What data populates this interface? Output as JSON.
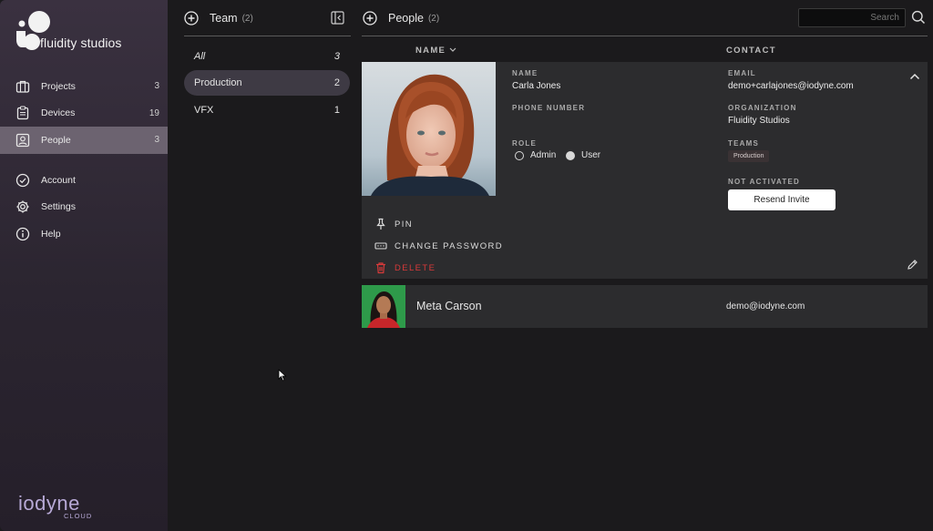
{
  "sidebar": {
    "logo_text": "fluidity studios",
    "items": [
      {
        "label": "Projects",
        "count": "3"
      },
      {
        "label": "Devices",
        "count": "19"
      },
      {
        "label": "People",
        "count": "3"
      },
      {
        "label": "Account",
        "count": ""
      },
      {
        "label": "Settings",
        "count": ""
      },
      {
        "label": "Help",
        "count": ""
      }
    ],
    "brand": "iodyne",
    "brand_sub": "CLOUD"
  },
  "team": {
    "title": "Team",
    "count": "(2)",
    "items": [
      {
        "label": "All",
        "count": "3"
      },
      {
        "label": "Production",
        "count": "2"
      },
      {
        "label": "VFX",
        "count": "1"
      }
    ]
  },
  "people": {
    "title": "People",
    "count": "(2)",
    "search_placeholder": "Search",
    "columns": {
      "name": "NAME",
      "contact": "CONTACT"
    },
    "expanded": {
      "name_label": "NAME",
      "name": "Carla Jones",
      "phone_label": "PHONE NUMBER",
      "role_label": "ROLE",
      "role_admin": "Admin",
      "role_user": "User",
      "email_label": "EMAIL",
      "email": "demo+carlajones@iodyne.com",
      "org_label": "ORGANIZATION",
      "org": "Fluidity Studios",
      "teams_label": "TEAMS",
      "team_tag": "Production",
      "status_label": "NOT ACTIVATED",
      "resend_label": "Resend Invite",
      "actions": {
        "pin": "PIN",
        "change_password": "CHANGE PASSWORD",
        "delete": "DELETE"
      }
    },
    "rows": [
      {
        "name": "Meta Carson",
        "email": "demo@iodyne.com"
      }
    ]
  },
  "colors": {
    "accent_active": "#6c6370",
    "danger": "#d83a3a",
    "brand": "#b7a9d6"
  }
}
